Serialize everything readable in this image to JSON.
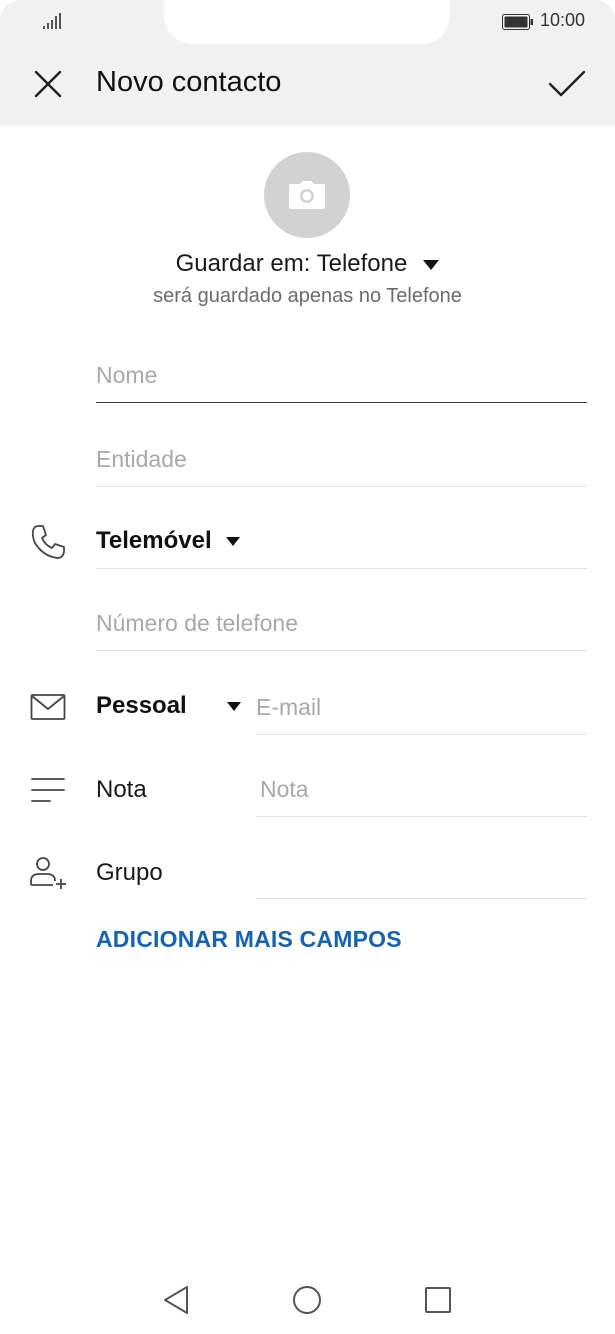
{
  "status_bar": {
    "time": "10:00"
  },
  "header": {
    "title": "Novo contacto"
  },
  "storage": {
    "label": "Guardar em: Telefone",
    "note": "será guardado apenas no Telefone"
  },
  "form": {
    "name_placeholder": "Nome",
    "company_placeholder": "Entidade",
    "phone_type": "Telemóvel",
    "phone_placeholder": "Número de telefone",
    "email_type": "Pessoal",
    "email_placeholder": "E-mail",
    "note_label": "Nota",
    "note_placeholder": "Nota",
    "group_label": "Grupo",
    "add_more_label": "ADICIONAR MAIS CAMPOS"
  },
  "icons": {
    "close": "close-icon",
    "confirm": "check-icon",
    "camera": "camera-icon",
    "phone": "phone-icon",
    "email": "envelope-icon",
    "note": "note-lines-icon",
    "group": "group-add-icon"
  },
  "colors": {
    "accent": "#1463b6",
    "header_bg": "#f1f1f1",
    "avatar_bg": "#d2d2d2",
    "placeholder": "#a8a8a8"
  }
}
